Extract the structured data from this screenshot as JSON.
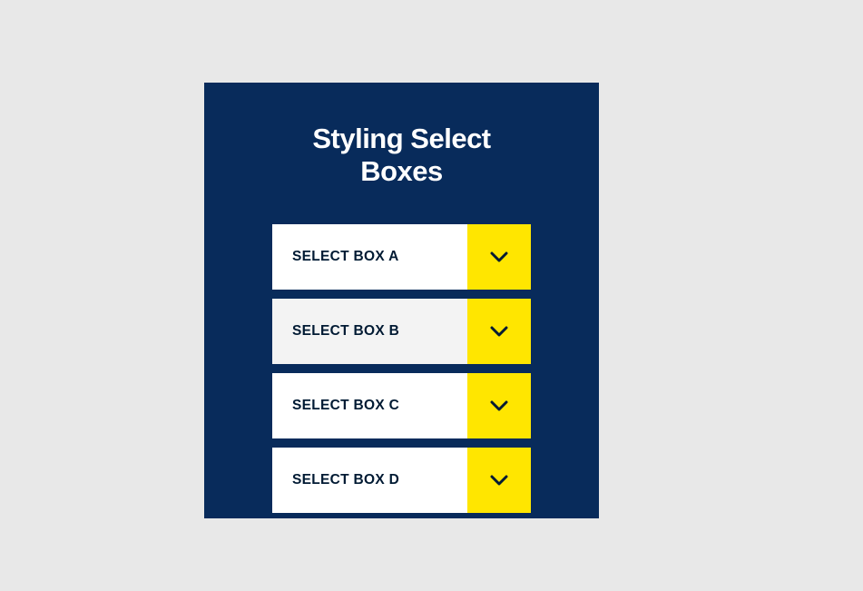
{
  "panel": {
    "title": "Styling Select Boxes",
    "selects": [
      {
        "label": "SELECT BOX A",
        "hover": false
      },
      {
        "label": "SELECT BOX B",
        "hover": true
      },
      {
        "label": "SELECT BOX C",
        "hover": false
      },
      {
        "label": "SELECT BOX D",
        "hover": false
      }
    ]
  },
  "colors": {
    "panel_bg": "#082b5b",
    "accent": "#ffe600",
    "page_bg": "#e8e8e8"
  }
}
